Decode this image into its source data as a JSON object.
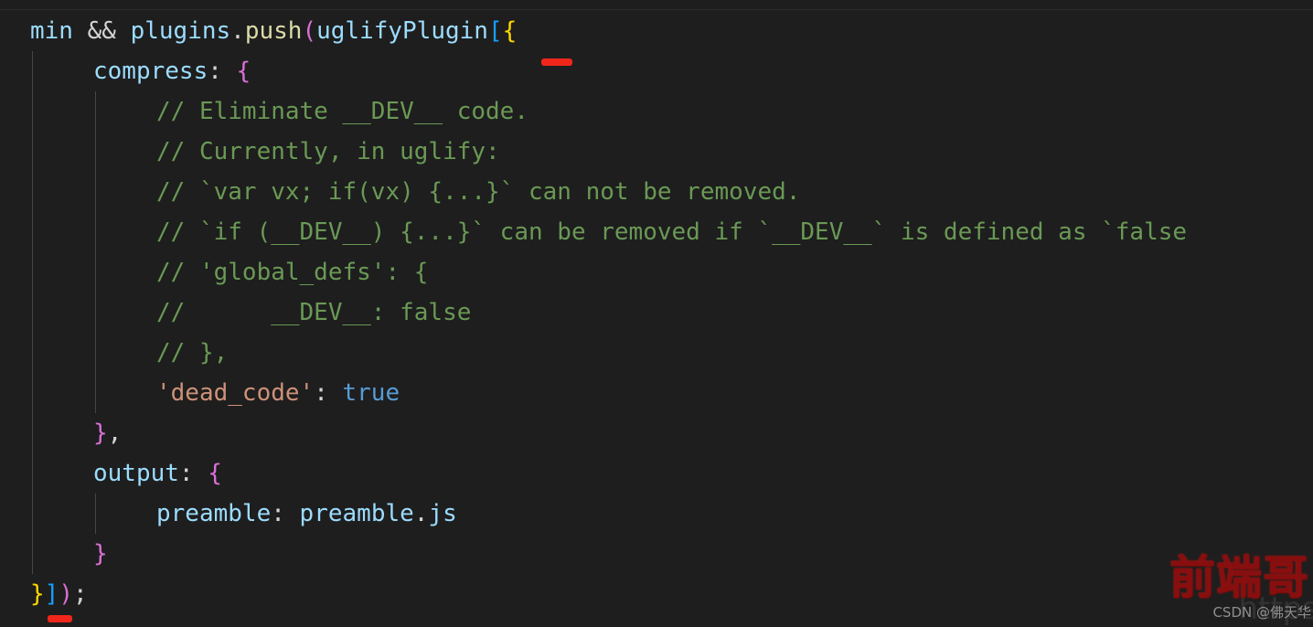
{
  "editor": {
    "background": "#1e1e1e",
    "foreground": "#d4d4d4",
    "language": "javascript",
    "indent_guide_color": "#474747"
  },
  "colors": {
    "variable": "#9cdcfe",
    "function": "#dcdcaa",
    "comment": "#6a9955",
    "string": "#ce9178",
    "keyword": "#569cd6",
    "bracket_yellow": "#ffd700",
    "bracket_magenta": "#da70d6",
    "bracket_blue": "#179fff",
    "marker_red": "#f1261a",
    "watermark_red": "#8e0f0f"
  },
  "code": {
    "lines": [
      {
        "indent": 0,
        "tokens": [
          {
            "t": "min",
            "c": "var"
          },
          {
            "t": " ",
            "c": "plain"
          },
          {
            "t": "&&",
            "c": "plain"
          },
          {
            "t": " ",
            "c": "plain"
          },
          {
            "t": "plugins",
            "c": "var"
          },
          {
            "t": ".",
            "c": "plain"
          },
          {
            "t": "push",
            "c": "fn"
          },
          {
            "t": "(",
            "c": "paren-m"
          },
          {
            "t": "uglifyPlugin",
            "c": "var"
          },
          {
            "t": "[",
            "c": "brack-b"
          },
          {
            "t": "{",
            "c": "brace-y"
          }
        ]
      },
      {
        "indent": 1,
        "tokens": [
          {
            "t": "compress",
            "c": "var"
          },
          {
            "t": ": ",
            "c": "plain"
          },
          {
            "t": "{",
            "c": "brace-p"
          }
        ]
      },
      {
        "indent": 2,
        "tokens": [
          {
            "t": "// Eliminate __DEV__ code.",
            "c": "comment"
          }
        ]
      },
      {
        "indent": 2,
        "tokens": [
          {
            "t": "// Currently, in uglify:",
            "c": "comment"
          }
        ]
      },
      {
        "indent": 2,
        "tokens": [
          {
            "t": "// `var vx; if(vx) {...}` can not be removed.",
            "c": "comment"
          }
        ]
      },
      {
        "indent": 2,
        "tokens": [
          {
            "t": "// `if (__DEV__) {...}` can be removed if `__DEV__` is defined as `false",
            "c": "comment"
          }
        ]
      },
      {
        "indent": 2,
        "tokens": [
          {
            "t": "// 'global_defs': {",
            "c": "comment"
          }
        ]
      },
      {
        "indent": 2,
        "tokens": [
          {
            "t": "//      __DEV__: false",
            "c": "comment"
          }
        ]
      },
      {
        "indent": 2,
        "tokens": [
          {
            "t": "// },",
            "c": "comment"
          }
        ]
      },
      {
        "indent": 2,
        "tokens": [
          {
            "t": "'dead_code'",
            "c": "string"
          },
          {
            "t": ": ",
            "c": "plain"
          },
          {
            "t": "true",
            "c": "kw-blue"
          }
        ]
      },
      {
        "indent": 1,
        "tokens": [
          {
            "t": "}",
            "c": "brace-p"
          },
          {
            "t": ",",
            "c": "plain"
          }
        ]
      },
      {
        "indent": 1,
        "tokens": [
          {
            "t": "output",
            "c": "var"
          },
          {
            "t": ": ",
            "c": "plain"
          },
          {
            "t": "{",
            "c": "brace-p"
          }
        ]
      },
      {
        "indent": 2,
        "tokens": [
          {
            "t": "preamble",
            "c": "var"
          },
          {
            "t": ": ",
            "c": "plain"
          },
          {
            "t": "preamble",
            "c": "var"
          },
          {
            "t": ".",
            "c": "plain"
          },
          {
            "t": "js",
            "c": "var"
          }
        ]
      },
      {
        "indent": 1,
        "tokens": [
          {
            "t": "}",
            "c": "brace-p"
          }
        ]
      },
      {
        "indent": 0,
        "tokens": [
          {
            "t": "}",
            "c": "brace-y"
          },
          {
            "t": "]",
            "c": "brack-b"
          },
          {
            "t": ")",
            "c": "paren-m"
          },
          {
            "t": ";",
            "c": "plain"
          }
        ]
      }
    ]
  },
  "annotations": {
    "markers": [
      {
        "name": "red-marker-top",
        "label": ""
      },
      {
        "name": "red-marker-bottom",
        "label": ""
      }
    ]
  },
  "watermark": {
    "big_text": "前端哥",
    "credit_text": "CSDN @佛天华",
    "ghost_text": "https"
  }
}
